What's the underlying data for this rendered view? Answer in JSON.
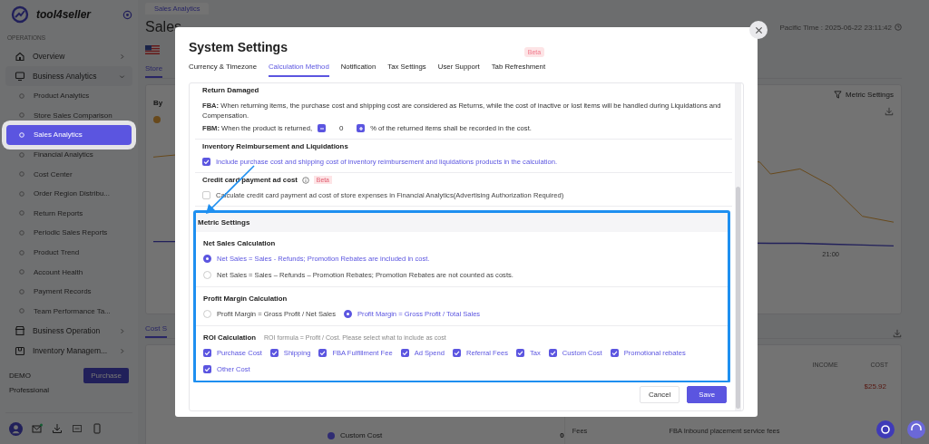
{
  "sidebar": {
    "brand": "tool4seller",
    "section": "OPERATIONS",
    "items": [
      {
        "label": "Overview",
        "expanded": false
      },
      {
        "label": "Business Analytics",
        "expanded": true,
        "children": [
          {
            "label": "Product Analytics",
            "selected": false
          },
          {
            "label": "Store Sales Comparison",
            "selected": false
          },
          {
            "label": "Sales Analytics",
            "selected": true
          },
          {
            "label": "Financial Analytics",
            "selected": false
          },
          {
            "label": "Cost Center",
            "selected": false
          },
          {
            "label": "Order Region Distribu...",
            "selected": false
          },
          {
            "label": "Return Reports",
            "selected": false
          },
          {
            "label": "Periodic Sales Reports",
            "selected": false
          },
          {
            "label": "Product Trend",
            "selected": false
          },
          {
            "label": "Account Health",
            "selected": false
          },
          {
            "label": "Payment Records",
            "selected": false
          },
          {
            "label": "Team Performance Ta...",
            "selected": false
          }
        ]
      },
      {
        "label": "Business Operation",
        "expanded": false
      },
      {
        "label": "Inventory Managem...",
        "expanded": false
      }
    ],
    "plan": {
      "name": "DEMO",
      "tier": "Professional",
      "button": "Purchase"
    }
  },
  "page": {
    "tab": "Sales Analytics",
    "title": "Sales",
    "time": "Pacific Time : 2025-06-22 23:11:42",
    "store_tab": {
      "label": "Store",
      "selected": true
    },
    "by_label": "By",
    "metric_settings": "Metric Settings",
    "x_label": "21:00",
    "cost_tab": {
      "label": "Cost S",
      "selected": true
    },
    "table": {
      "columns": [
        "INCOME",
        "COST"
      ],
      "value": "$25.92"
    },
    "bottom_row": {
      "category": "Custom Cost",
      "count": "0",
      "fee_group": "Fees",
      "fee_name": "FBA Inbound placement service fees"
    }
  },
  "modal": {
    "title": "System Settings",
    "tabs": [
      {
        "label": "Currency & Timezone",
        "selected": false
      },
      {
        "label": "Calculation Method",
        "selected": true
      },
      {
        "label": "Notification",
        "selected": false
      },
      {
        "label": "Tax Settings",
        "selected": false
      },
      {
        "label": "User Support",
        "selected": false
      },
      {
        "label": "Tab Refreshment",
        "selected": false,
        "badge": "Beta"
      }
    ],
    "return_damaged": {
      "title": "Return Damaged",
      "fba": "**FBA:** When returning items, the purchase cost and shipping cost are considered as Returns, while the cost of inactive or lost items will be handled during Liquidations and Compensation.",
      "fbm_prefix": "**FBM:** When the product is returned,",
      "fbm_value": "0",
      "fbm_suffix": "% of the returned items shall be recorded in the cost."
    },
    "inventory": {
      "title": "Inventory Reimbursement and Liquidations",
      "option": {
        "label": "Include purchase cost and shipping cost of inventory reimbursement and liquidations products in the calculation.",
        "checked": true
      }
    },
    "credit_card": {
      "title": "Credit card payment ad cost",
      "badge": "Beta",
      "option": {
        "label": "Calculate credit card payment ad cost of store expenses in Financial Analytics(Advertising Authorization Required)",
        "checked": false
      }
    },
    "metric_settings": {
      "title": "Metric Settings",
      "highlighted": true,
      "groups": [
        {
          "title": "Net Sales Calculation",
          "kind": "radio",
          "options": [
            {
              "label": "Net Sales = Sales - Refunds; Promotion Rebates are included in cost.",
              "selected": true
            },
            {
              "label": "Net Sales = Sales – Refunds – Promotion Rebates; Promotion Rebates are not counted as costs.",
              "selected": false
            }
          ]
        },
        {
          "title": "Profit Margin Calculation",
          "kind": "radio",
          "options": [
            {
              "label": "Profit Margin = Gross Profit / Net Sales",
              "selected": false
            },
            {
              "label": "Profit Margin = Gross Profit / Total Sales",
              "selected": true
            }
          ]
        },
        {
          "title": "ROI Calculation",
          "kind": "checkbox",
          "hint": "ROI formula = Profit / Cost. Please select what to include as cost",
          "options": [
            {
              "label": "Purchase Cost",
              "checked": true
            },
            {
              "label": "Shipping",
              "checked": true
            },
            {
              "label": "FBA Fulfillment Fee",
              "checked": true
            },
            {
              "label": "Ad Spend",
              "checked": true
            },
            {
              "label": "Referral Fees",
              "checked": true
            },
            {
              "label": "Tax",
              "checked": true
            },
            {
              "label": "Custom Cost",
              "checked": true
            },
            {
              "label": "Promotional rebates",
              "checked": true
            },
            {
              "label": "Other Cost",
              "checked": true
            }
          ]
        }
      ]
    },
    "buttons": [
      {
        "label": "Cancel",
        "kind": "secondary"
      },
      {
        "label": "Save",
        "kind": "primary"
      }
    ]
  }
}
